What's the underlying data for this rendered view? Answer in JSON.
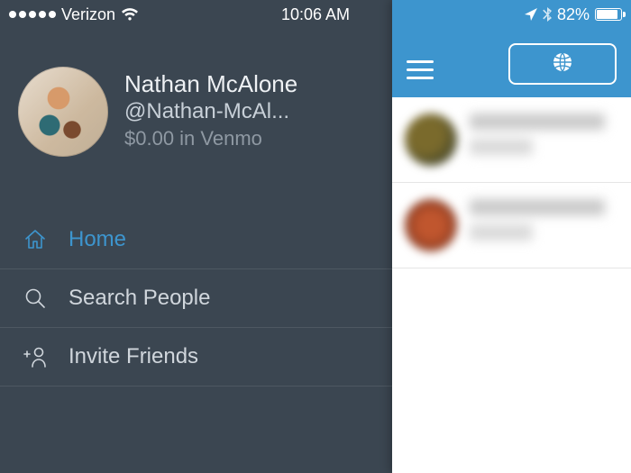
{
  "status_bar": {
    "carrier": "Verizon",
    "time": "10:06 AM",
    "battery_pct": "82%"
  },
  "profile": {
    "name": "Nathan McAlone",
    "handle": "@Nathan-McAl...",
    "balance": "$0.00 in Venmo"
  },
  "menu": {
    "home": "Home",
    "search": "Search People",
    "invite": "Invite Friends"
  },
  "colors": {
    "sidebar_bg": "#3b4651",
    "accent": "#3d95ce"
  }
}
